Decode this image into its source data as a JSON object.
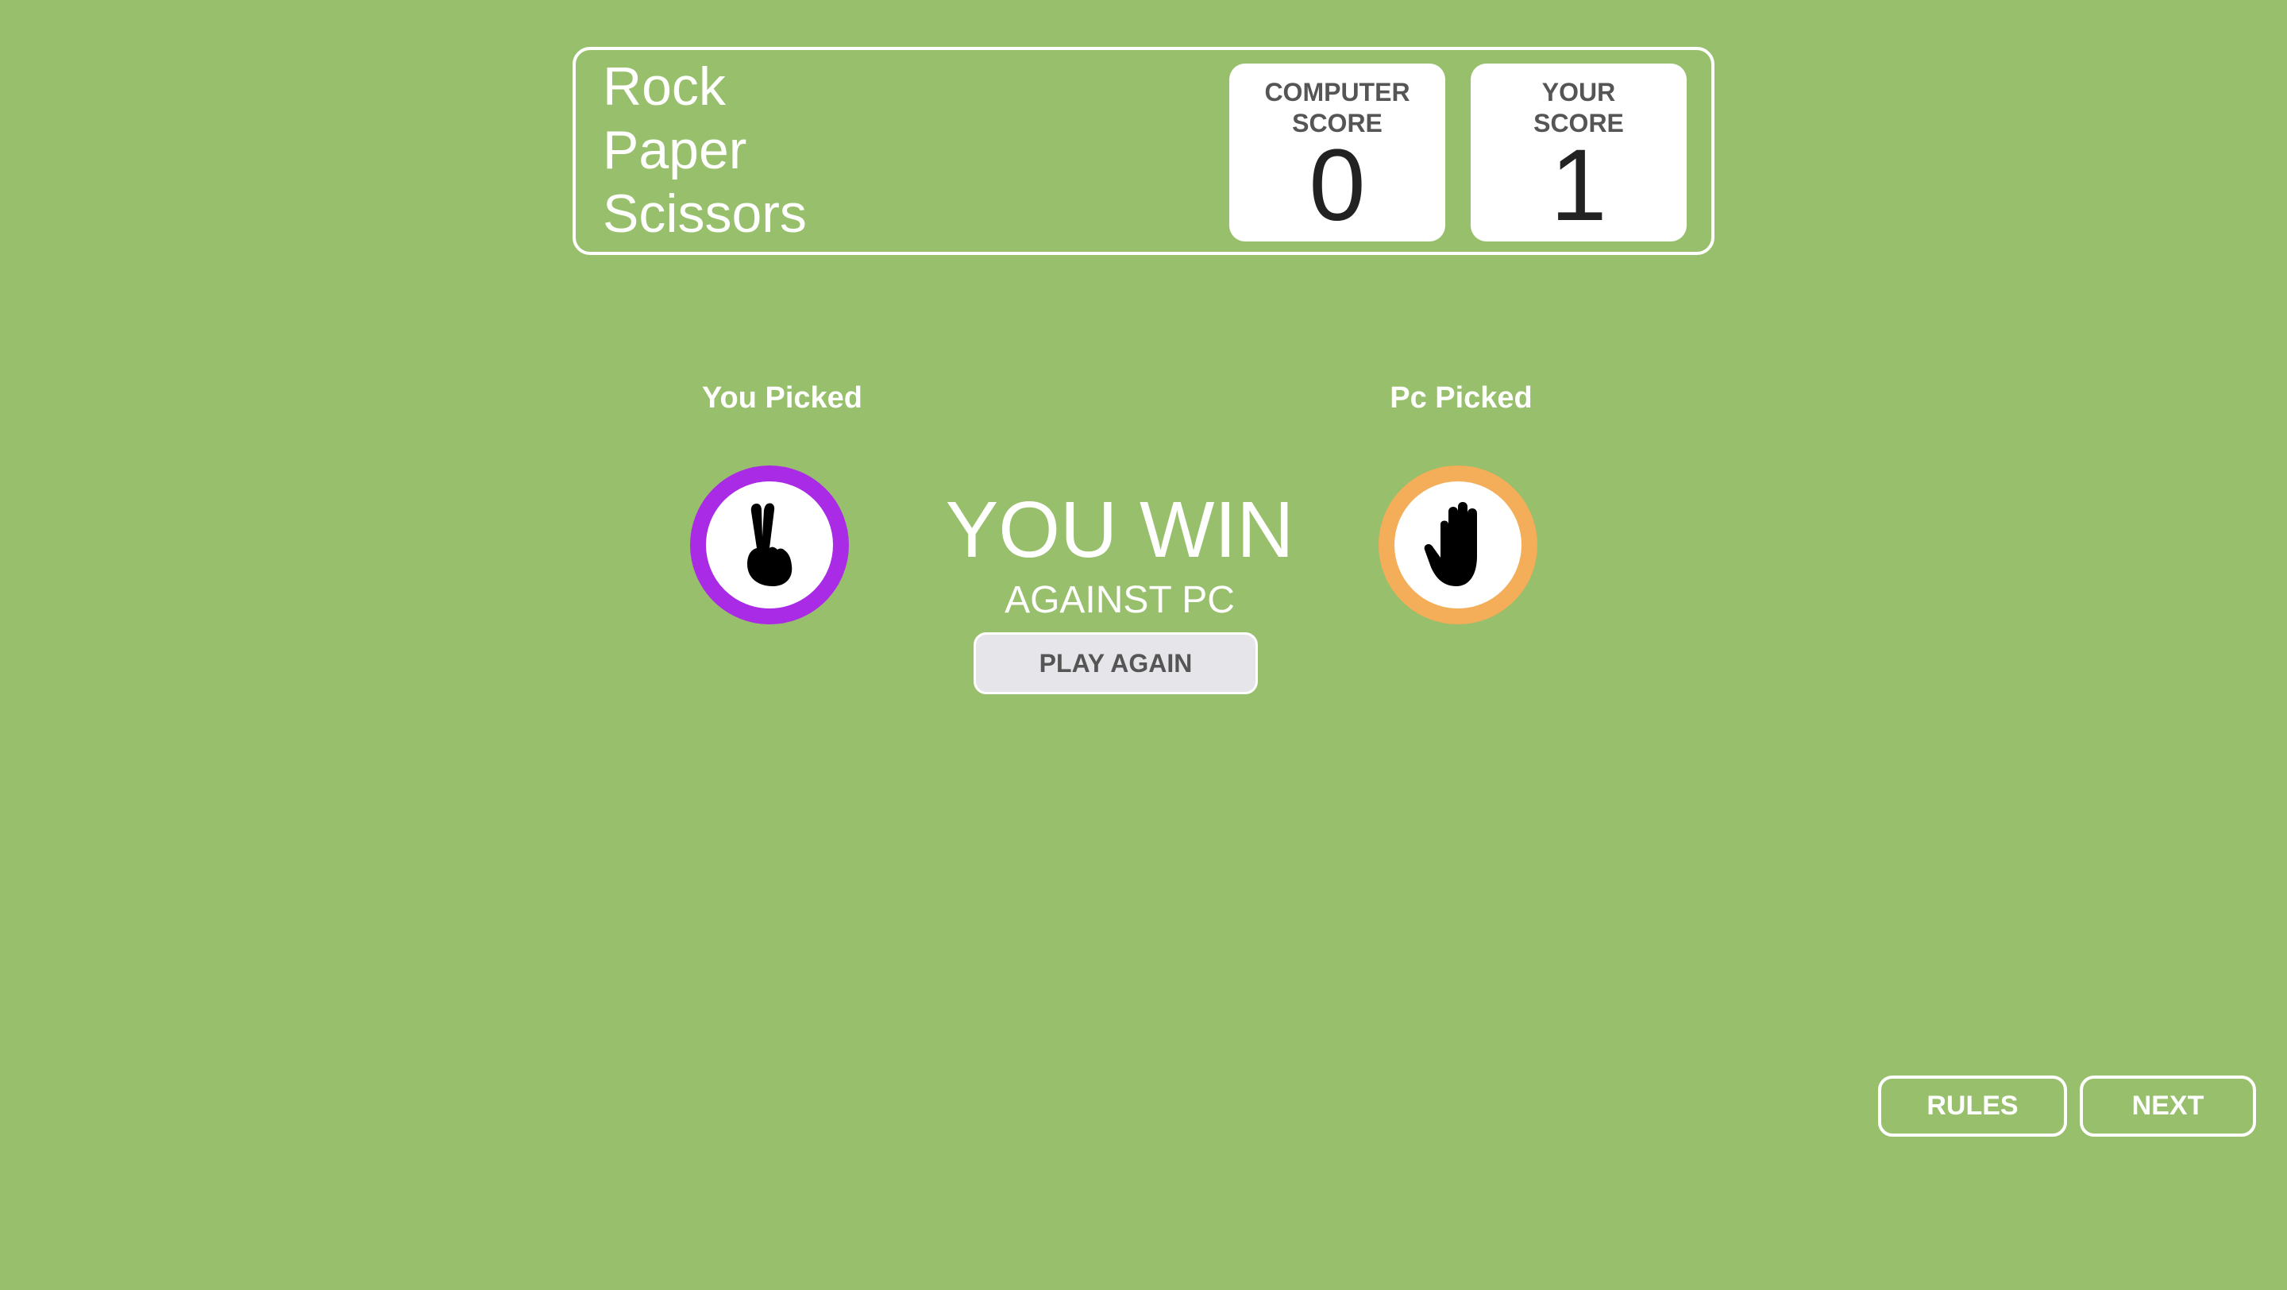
{
  "header": {
    "title_lines": [
      "Rock",
      "Paper",
      "Scissors"
    ],
    "computer_score_label": "COMPUTER\nSCORE",
    "computer_score": "0",
    "player_score_label": "YOUR\nSCORE",
    "player_score": "1"
  },
  "picks": {
    "you_label": "You Picked",
    "you_choice_icon": "scissors-hand-icon",
    "you_ring_color": "#a92be6",
    "pc_label": "Pc Picked",
    "pc_choice_icon": "paper-hand-icon",
    "pc_ring_color": "#f4ad58"
  },
  "result": {
    "title": "YOU WIN",
    "subtitle": "AGAINST PC",
    "play_again_label": "PLAY AGAIN"
  },
  "footer": {
    "rules_label": "RULES",
    "next_label": "NEXT"
  },
  "colors": {
    "background": "#98bf6c"
  }
}
